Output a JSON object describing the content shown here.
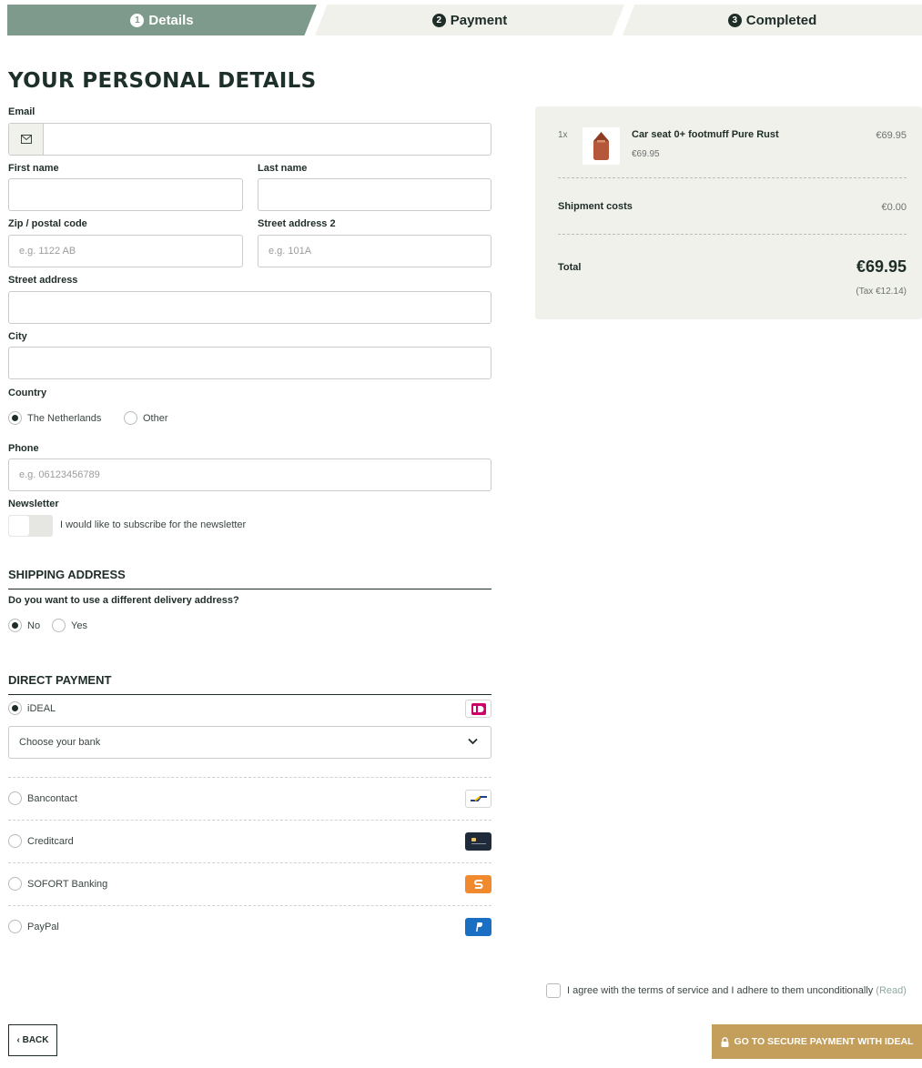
{
  "steps": [
    {
      "num": "1",
      "label": "Details"
    },
    {
      "num": "2",
      "label": "Payment"
    },
    {
      "num": "3",
      "label": "Completed"
    }
  ],
  "page_title": "YOUR PERSONAL DETAILS",
  "form": {
    "email": {
      "label": "Email",
      "value": "",
      "icon": "envelope-icon"
    },
    "first_name": {
      "label": "First name",
      "value": ""
    },
    "last_name": {
      "label": "Last name",
      "value": ""
    },
    "zip": {
      "label": "Zip / postal code",
      "placeholder": "e.g. 1122 AB"
    },
    "street2": {
      "label": "Street address 2",
      "placeholder": "e.g. 101A"
    },
    "street": {
      "label": "Street address",
      "value": ""
    },
    "city": {
      "label": "City",
      "value": ""
    },
    "country": {
      "label": "Country",
      "options": [
        "The Netherlands",
        "Other"
      ],
      "selected": "The Netherlands"
    },
    "phone": {
      "label": "Phone",
      "placeholder": "e.g. 06123456789"
    },
    "newsletter": {
      "label": "Newsletter",
      "text": "I would like to subscribe for the newsletter",
      "enabled": false
    }
  },
  "shipping": {
    "title": "SHIPPING ADDRESS",
    "question": "Do you want to use a different delivery address?",
    "options": [
      "No",
      "Yes"
    ],
    "selected": "No"
  },
  "payment": {
    "title": "DIRECT PAYMENT",
    "methods": [
      {
        "label": "iDEAL",
        "selected": true,
        "icon": "ideal-icon"
      },
      {
        "label": "Bancontact",
        "selected": false,
        "icon": "bancontact-icon"
      },
      {
        "label": "Creditcard",
        "selected": false,
        "icon": "creditcard-icon"
      },
      {
        "label": "SOFORT Banking",
        "selected": false,
        "icon": "sofort-icon"
      },
      {
        "label": "PayPal",
        "selected": false,
        "icon": "paypal-icon"
      }
    ],
    "bank_select": "Choose your bank"
  },
  "summary": {
    "qty": "1x",
    "product_name": "Car seat 0+ footmuff Pure Rust",
    "product_unit_price": "€69.95",
    "product_price": "€69.95",
    "shipment_label": "Shipment costs",
    "shipment_value": "€0.00",
    "total_label": "Total",
    "total_value": "€69.95",
    "tax": "(Tax €12.14)"
  },
  "terms": {
    "text": "I agree with the terms of service and I adhere to them unconditionally",
    "read": "(Read)"
  },
  "buttons": {
    "back": "‹ BACK",
    "go": "GO TO SECURE PAYMENT WITH IDEAL"
  },
  "colors": {
    "step_active": "#7d9a8c",
    "panel_bg": "#f1f1ec",
    "cta": "#c49e5b",
    "text_dark": "#1f2d28"
  }
}
